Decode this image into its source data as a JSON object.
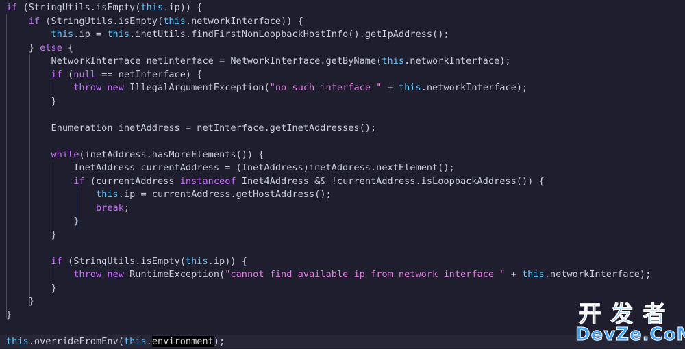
{
  "colors": {
    "background": "#1e1e2e",
    "keyword": "#c86bff",
    "this": "#58c8ff",
    "string": "#e07de0",
    "plain": "#c8ccd8",
    "guide": "#3d4a6a"
  },
  "code": {
    "lines": [
      [
        [
          "kw",
          "if"
        ],
        [
          "p",
          " (StringUtils.isEmpty("
        ],
        [
          "th",
          "this"
        ],
        [
          "p",
          ".ip)) {"
        ]
      ],
      [
        [
          "p",
          "    "
        ],
        [
          "kw",
          "if"
        ],
        [
          "p",
          " (StringUtils.isEmpty("
        ],
        [
          "th",
          "this"
        ],
        [
          "p",
          ".networkInterface)) {"
        ]
      ],
      [
        [
          "p",
          "        "
        ],
        [
          "th",
          "this"
        ],
        [
          "p",
          ".ip = "
        ],
        [
          "th",
          "this"
        ],
        [
          "p",
          ".inetUtils.findFirstNonLoopbackHostInfo().getIpAddress();"
        ]
      ],
      [
        [
          "p",
          "    } "
        ],
        [
          "kw",
          "else"
        ],
        [
          "p",
          " {"
        ]
      ],
      [
        [
          "p",
          "        NetworkInterface netInterface = NetworkInterface.getByName("
        ],
        [
          "th",
          "this"
        ],
        [
          "p",
          ".networkInterface);"
        ]
      ],
      [
        [
          "p",
          "        "
        ],
        [
          "kw",
          "if"
        ],
        [
          "p",
          " ("
        ],
        [
          "kw",
          "null"
        ],
        [
          "p",
          " == netInterface) {"
        ]
      ],
      [
        [
          "p",
          "            "
        ],
        [
          "kw",
          "throw"
        ],
        [
          "p",
          " "
        ],
        [
          "kw",
          "new"
        ],
        [
          "p",
          " IllegalArgumentException("
        ],
        [
          "str",
          "\"no such interface \""
        ],
        [
          "p",
          " + "
        ],
        [
          "th",
          "this"
        ],
        [
          "p",
          ".networkInterface);"
        ]
      ],
      [
        [
          "p",
          "        }"
        ]
      ],
      [],
      [
        [
          "p",
          "        Enumeration inetAddress = netInterface.getInetAddresses();"
        ]
      ],
      [],
      [
        [
          "p",
          "        "
        ],
        [
          "kw",
          "while"
        ],
        [
          "p",
          "(inetAddress.hasMoreElements()) {"
        ]
      ],
      [
        [
          "p",
          "            InetAddress currentAddress = (InetAddress)inetAddress.nextElement();"
        ]
      ],
      [
        [
          "p",
          "            "
        ],
        [
          "kw",
          "if"
        ],
        [
          "p",
          " (currentAddress "
        ],
        [
          "kw",
          "instanceof"
        ],
        [
          "p",
          " Inet4Address && !currentAddress.isLoopbackAddress()) {"
        ]
      ],
      [
        [
          "p",
          "                "
        ],
        [
          "th",
          "this"
        ],
        [
          "p",
          ".ip = currentAddress.getHostAddress();"
        ]
      ],
      [
        [
          "p",
          "                "
        ],
        [
          "kw",
          "break"
        ],
        [
          "p",
          ";"
        ]
      ],
      [
        [
          "p",
          "            }"
        ]
      ],
      [
        [
          "p",
          "        }"
        ]
      ],
      [],
      [
        [
          "p",
          "        "
        ],
        [
          "kw",
          "if"
        ],
        [
          "p",
          " (StringUtils.isEmpty("
        ],
        [
          "th",
          "this"
        ],
        [
          "p",
          ".ip)) {"
        ]
      ],
      [
        [
          "p",
          "            "
        ],
        [
          "kw",
          "throw"
        ],
        [
          "p",
          " "
        ],
        [
          "kw",
          "new"
        ],
        [
          "p",
          " RuntimeException("
        ],
        [
          "str",
          "\"cannot find available ip from network interface \""
        ],
        [
          "p",
          " + "
        ],
        [
          "th",
          "this"
        ],
        [
          "p",
          ".networkInterface);"
        ]
      ],
      [
        [
          "p",
          "        }"
        ]
      ],
      [
        [
          "p",
          "    }"
        ]
      ],
      [
        [
          "p",
          "}"
        ]
      ],
      [],
      [
        [
          "th",
          "this"
        ],
        [
          "p",
          ".overrideFromEnv("
        ],
        [
          "th",
          "this"
        ],
        [
          "p",
          "."
        ],
        [
          "hl",
          "environment"
        ],
        [
          "p",
          ");"
        ]
      ]
    ]
  },
  "watermark": {
    "cn": "开发者",
    "en": "DevZe.CoM"
  }
}
